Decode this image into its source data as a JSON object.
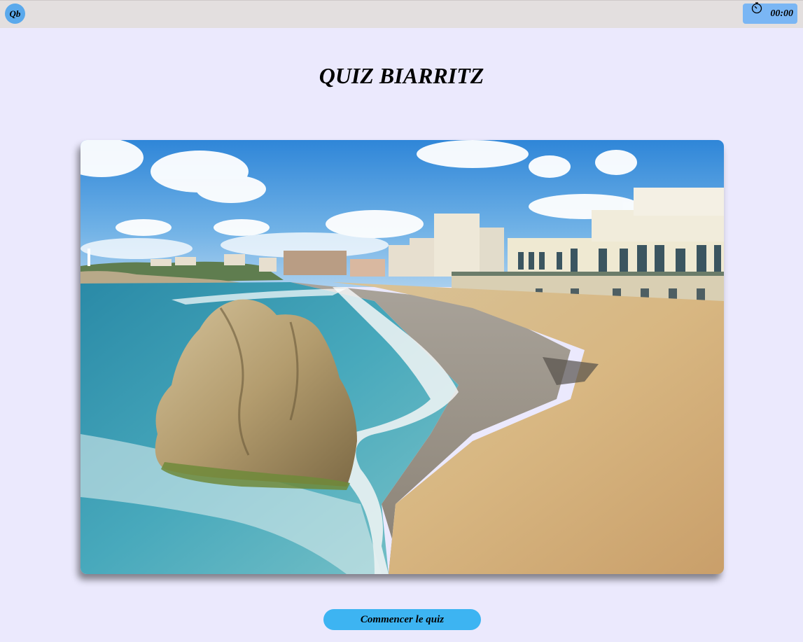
{
  "header": {
    "logo_text": "Qb",
    "timer_value": "00:00",
    "timer_icon": "stopwatch-icon"
  },
  "main": {
    "title": "QUIZ BIARRITZ",
    "start_button_label": "Commencer le quiz"
  },
  "colors": {
    "background": "#ebe9fd",
    "topbar": "#e3dfdf",
    "logo": "#5aa9ec",
    "timer": "#7ab6f4",
    "button": "#3db4f2"
  }
}
